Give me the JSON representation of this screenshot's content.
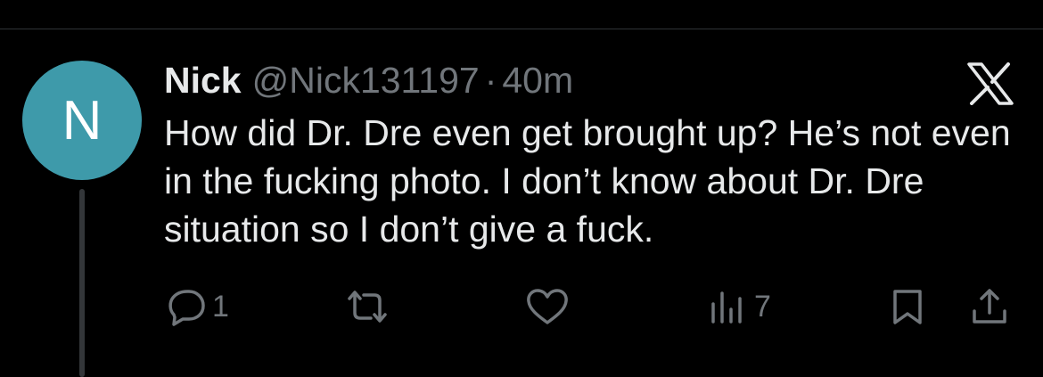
{
  "tweet": {
    "avatar_initial": "N",
    "avatar_color": "#3e9aaa",
    "display_name": "Nick",
    "handle": "@Nick131197",
    "separator": "·",
    "timestamp": "40m",
    "text": "How did Dr. Dre even get brought up? He’s not even in the fucking photo. I don’t know about Dr. Dre situation so I don’t give a fuck."
  },
  "actions": {
    "reply_icon": "speech-bubble-icon",
    "reply_count": "1",
    "retweet_icon": "retweet-icon",
    "like_icon": "heart-icon",
    "views_icon": "bar-chart-icon",
    "views_count": "7",
    "bookmark_icon": "bookmark-icon",
    "share_icon": "share-upload-icon"
  },
  "colors": {
    "background": "#000000",
    "primary_text": "#e7e9ea",
    "secondary_text": "#71767b",
    "divider": "#2f3336"
  }
}
